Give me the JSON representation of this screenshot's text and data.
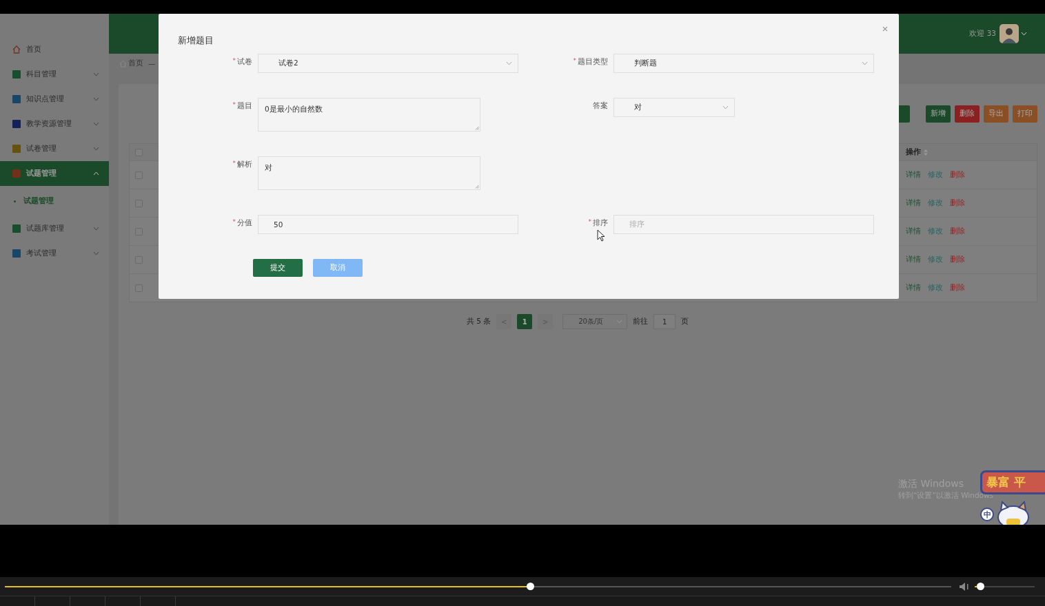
{
  "sidebar": {
    "items": [
      {
        "label": "首页",
        "kind": "link",
        "expanded": false,
        "selected": false,
        "color": "#70341d"
      },
      {
        "label": "科目管理",
        "kind": "group",
        "expanded": false,
        "selected": false,
        "color": "#174f2c"
      },
      {
        "label": "知识点管理",
        "kind": "group",
        "expanded": false,
        "selected": false,
        "color": "#174768"
      },
      {
        "label": "教学资源管理",
        "kind": "group",
        "expanded": false,
        "selected": false,
        "color": "#142258"
      },
      {
        "label": "试卷管理",
        "kind": "group",
        "expanded": false,
        "selected": false,
        "color": "#64520e"
      },
      {
        "label": "试题管理",
        "kind": "group",
        "expanded": true,
        "selected": true,
        "color": "#703117",
        "children": [
          {
            "label": "试题管理",
            "selected": true
          }
        ]
      },
      {
        "label": "试题库管理",
        "kind": "group",
        "expanded": false,
        "selected": false,
        "color": "#174f2c"
      },
      {
        "label": "考试管理",
        "kind": "group",
        "expanded": false,
        "selected": false,
        "color": "#174768"
      }
    ]
  },
  "header": {
    "welcome": "欢迎 33"
  },
  "breadcrumb": {
    "home": "首页",
    "separator": "—"
  },
  "toolbar": {
    "buttons": [
      {
        "label": "新增",
        "kind": "primary"
      },
      {
        "label": "删除",
        "kind": "danger"
      },
      {
        "label": "导出",
        "kind": "warning"
      },
      {
        "label": "打印",
        "kind": "warning"
      }
    ]
  },
  "table": {
    "header_checked": false,
    "columns": [
      {
        "label": "操作",
        "sortable": true
      }
    ],
    "rows": [
      {
        "checked": false,
        "actions": [
          {
            "label": "详情",
            "kind": "view"
          },
          {
            "label": "修改",
            "kind": "edit"
          },
          {
            "label": "删除",
            "kind": "delete"
          }
        ]
      },
      {
        "checked": false,
        "actions": [
          {
            "label": "详情",
            "kind": "view"
          },
          {
            "label": "修改",
            "kind": "edit"
          },
          {
            "label": "删除",
            "kind": "delete"
          }
        ]
      },
      {
        "checked": false,
        "actions": [
          {
            "label": "详情",
            "kind": "view"
          },
          {
            "label": "修改",
            "kind": "edit"
          },
          {
            "label": "删除",
            "kind": "delete"
          }
        ]
      },
      {
        "checked": false,
        "actions": [
          {
            "label": "详情",
            "kind": "view"
          },
          {
            "label": "修改",
            "kind": "edit"
          },
          {
            "label": "删除",
            "kind": "delete"
          }
        ]
      },
      {
        "checked": false,
        "actions": [
          {
            "label": "详情",
            "kind": "view"
          },
          {
            "label": "修改",
            "kind": "edit"
          },
          {
            "label": "删除",
            "kind": "delete"
          }
        ]
      }
    ]
  },
  "pagination": {
    "total": "共 5 条",
    "prev": "<",
    "pages": [
      {
        "label": "1",
        "selected": true
      }
    ],
    "next": ">",
    "page_size": "20条/页",
    "goto_label": "前往",
    "goto_value": "1",
    "goto_suffix": "页"
  },
  "modal": {
    "title": "新增题目",
    "rows": [
      [
        {
          "label": "试卷",
          "required_mark": "*",
          "kind": "select",
          "value": "试卷2"
        },
        {
          "label": "题目类型",
          "required_mark": "*",
          "kind": "select",
          "value": "判断题"
        }
      ],
      [
        {
          "label": "题目",
          "required_mark": "*",
          "kind": "textarea",
          "value": "0是最小的自然数"
        },
        {
          "label": "答案",
          "kind": "small-select",
          "value": "对"
        }
      ],
      [
        {
          "label": "解析",
          "required_mark": "*",
          "kind": "textarea",
          "value": "对"
        }
      ],
      [
        {
          "label": "分值",
          "required_mark": "*",
          "kind": "input",
          "value": "50"
        },
        {
          "label": "排序",
          "required_mark": "*",
          "kind": "input",
          "placeholder": "排序"
        }
      ]
    ],
    "buttons": [
      {
        "label": "提交",
        "kind": "primary"
      },
      {
        "label": "取消",
        "kind": "secondary"
      }
    ]
  },
  "windows_notice": {
    "title": "激活 Windows",
    "hint": "转到“设置”以激活 Windows"
  },
  "sticker": {
    "texts": [
      "暴富",
      "平"
    ],
    "ime": "中"
  },
  "player": {
    "progress": {
      "level": 0.555
    },
    "volume": {
      "level": 0.1
    }
  }
}
